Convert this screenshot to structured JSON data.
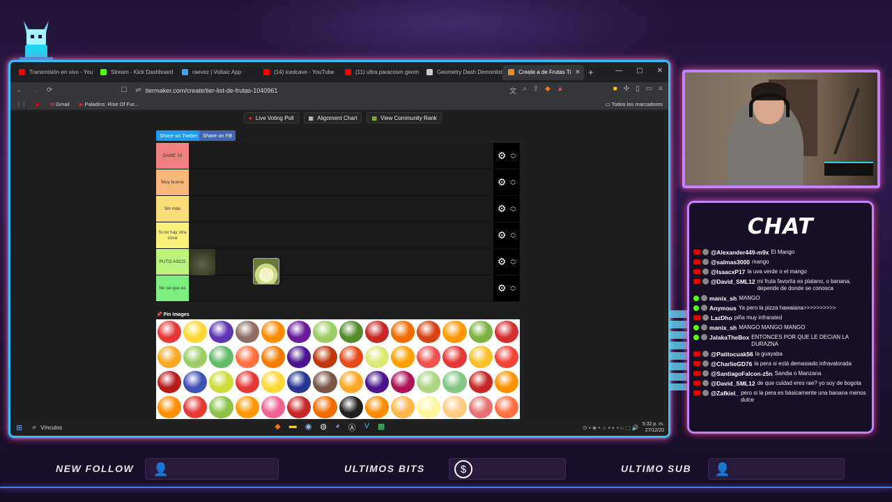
{
  "browser": {
    "tabs": [
      {
        "label": "Transmisión en vivo - You",
        "color": "#ff0000",
        "active": false
      },
      {
        "label": "Stream - Kick Dashboard",
        "color": "#53fc18",
        "active": false
      },
      {
        "label": "raevez | Voltaic App",
        "color": "#3ba3ff",
        "active": false
      },
      {
        "label": "(14) icedcave - YouTube",
        "color": "#ff0000",
        "active": false
      },
      {
        "label": "(11) ultra paracosm geom",
        "color": "#ff0000",
        "active": false
      },
      {
        "label": "Geometry Dash Demonlist",
        "color": "#cccccc",
        "active": false
      },
      {
        "label": "Create a de Frutas Ti",
        "color": "#f28b25",
        "active": true
      }
    ],
    "url": "tiermaker.com/create/tier-list-de-frutas-1040961",
    "bookmarks": [
      {
        "label": "Gmail",
        "color": "#ea4335"
      },
      {
        "label": "Paladins: Rise Of Fur...",
        "color": "#d32f2f"
      }
    ],
    "bookmarks_all": "Todos los marcadores"
  },
  "page": {
    "top_buttons": [
      {
        "label": "Live Voting Poll",
        "icon": "record-icon"
      },
      {
        "label": "Alignment Chart",
        "icon": "grid-icon"
      },
      {
        "label": "View Community Rank",
        "icon": "rank-icon"
      }
    ],
    "share_twitter": "Share on Twitter",
    "share_fb": "Share on FB",
    "tiers": [
      {
        "label": "DAME 10",
        "color": "#f08080"
      },
      {
        "label": "Muy buena",
        "color": "#f7b77a"
      },
      {
        "label": "Sin más",
        "color": "#f8dd78"
      },
      {
        "label": "Si no hay otra cosa",
        "color": "#fbf27e"
      },
      {
        "label": "PUTO ASCO",
        "color": "#bdf27c"
      },
      {
        "label": "No sé que es",
        "color": "#7bee7e"
      }
    ],
    "pin_images": "Pin Images",
    "fruit_colors": [
      "#e53935",
      "#fdd835",
      "#5e35b1",
      "#8d6e63",
      "#fb8c00",
      "#6a1b9a",
      "#9ccc65",
      "#558b2f",
      "#c62828",
      "#ef6c00",
      "#d84315",
      "#ff9800",
      "#7cb342",
      "#d32f2f",
      "#f9a825",
      "#9ccc65",
      "#66bb6a",
      "#ff7043",
      "#f57c00",
      "#4a148c",
      "#bf360c",
      "#e64a19",
      "#dce775",
      "#ffa000",
      "#ef5350",
      "#e53935",
      "#fbc02d",
      "#f44336",
      "#b71c1c",
      "#3f51b5",
      "#cddc39",
      "#e53935",
      "#fdd835",
      "#283593",
      "#795548",
      "#ffa726",
      "#4a148c",
      "#ad1457",
      "#aed581",
      "#81c784",
      "#c62828",
      "#ff9100",
      "#ff8f00",
      "#e53935",
      "#8bc34a",
      "#ff9800",
      "#f06292",
      "#c62828",
      "#ef6c00",
      "#212121",
      "#fb8c00",
      "#ffb74d",
      "#fff59d",
      "#ffcc80",
      "#e57373",
      "#ff7043"
    ]
  },
  "taskbar": {
    "search": "Vínculos",
    "time": "5:32 p. m.",
    "date": "27/12/20"
  },
  "chat": {
    "title": "CHAT",
    "messages": [
      {
        "platform": "yt",
        "user": "@Alexander449-m9x",
        "text": "El Mango"
      },
      {
        "platform": "yt",
        "user": "@salmas3000",
        "text": "mango"
      },
      {
        "platform": "yt",
        "user": "@IsaacxP17",
        "text": "la uva verde o el mango"
      },
      {
        "platform": "yt",
        "user": "@David_SML12",
        "text": "mi fruta favorita es platano, o banana, depende de donde se conosca"
      },
      {
        "platform": "kick",
        "user": "manix_sh",
        "text": "MANGO"
      },
      {
        "platform": "kick",
        "user": "Anymous",
        "text": "Ya pero la pizza hawaiana>>>>>>>>>>"
      },
      {
        "platform": "yt",
        "user": "LazDho",
        "text": "piña muy infrarated"
      },
      {
        "platform": "kick",
        "user": "manix_sh",
        "text": "MANGO MANGO MANGO"
      },
      {
        "platform": "kick",
        "user": "JalakaTheBox",
        "text": "ENTONCES POR QUE LE DECIAN LA DURAZNA"
      },
      {
        "platform": "yt",
        "user": "@Patitocuak56",
        "text": "la guayaba"
      },
      {
        "platform": "yt",
        "user": "@CharlieGD76",
        "text": "la pera si está demasiado infravalorada"
      },
      {
        "platform": "yt",
        "user": "@SantiagoFalcon-z5n",
        "text": "Sandia o Manzana"
      },
      {
        "platform": "yt",
        "user": "@David_SML12",
        "text": "de que cuidad eres rae? yo soy de bogota"
      },
      {
        "platform": "yt",
        "user": "@Zafkiel_",
        "text": "pero si la pera es básicamente una banana menos dulce"
      }
    ]
  },
  "overlay": {
    "new_follow": "NEW FOLLOW",
    "ultimos_bits": "ULTIMOS BITS",
    "ultimo_sub": "ULTIMO SUB"
  }
}
